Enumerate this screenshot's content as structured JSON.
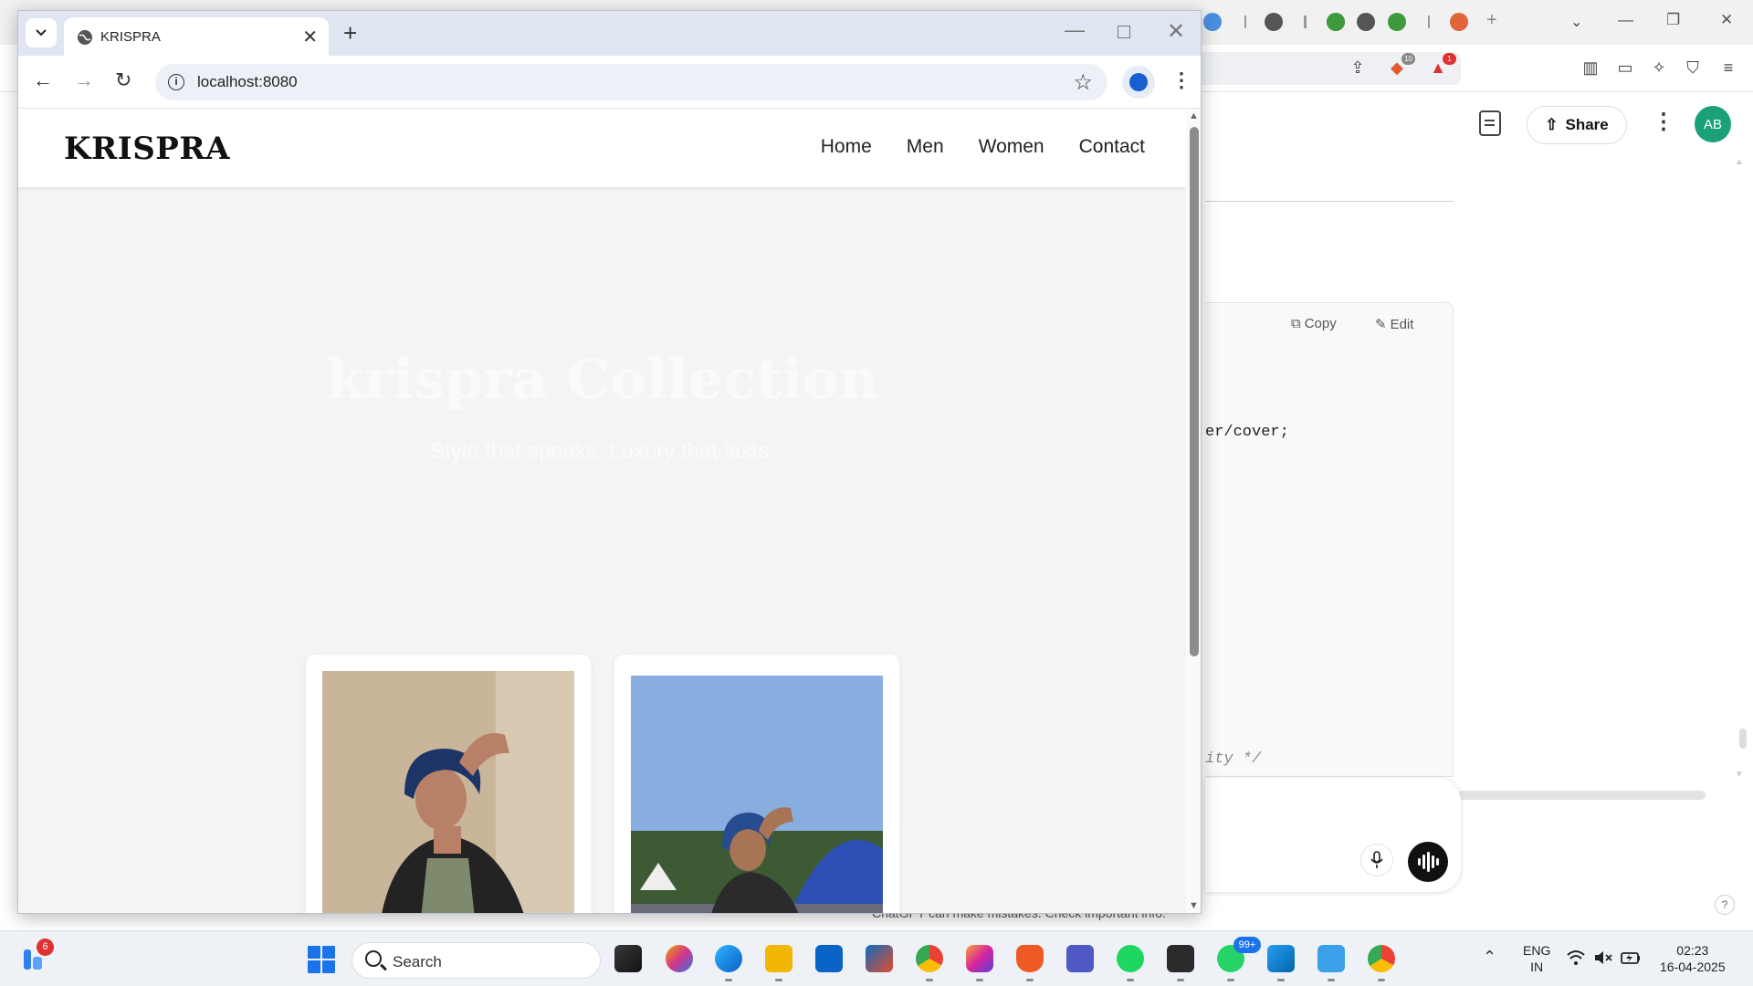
{
  "background_browser": {
    "chat": {
      "share_label": "Share",
      "avatar_initials": "AB",
      "copy_label": "Copy",
      "edit_label": "Edit",
      "code_fragment_1": "er/cover;",
      "code_fragment_2": "ity */",
      "disclaimer": "ChatGPT can make mistakes. Check important info.",
      "help_label": "?"
    },
    "brave_badge": "10",
    "alert_badge": "1"
  },
  "browser": {
    "tab": {
      "title": "KRISPRA"
    },
    "url": "localhost:8080"
  },
  "site": {
    "logo": "KRISPRA",
    "nav": [
      "Home",
      "Men",
      "Women",
      "Contact"
    ],
    "hero_title": "krispra Collection",
    "hero_subtitle": "Style that speaks. Luxury that lasts."
  },
  "taskbar": {
    "widgets_badge": "6",
    "search_placeholder": "Search",
    "whatsapp_badge": "99+",
    "lang_line1": "ENG",
    "lang_line2": "IN",
    "time": "02:23",
    "date": "16-04-2025"
  },
  "colors": {
    "accent_blue": "#1a73e8",
    "avatar_green": "#1aa179",
    "hero_bg": "#f4f4f4"
  }
}
